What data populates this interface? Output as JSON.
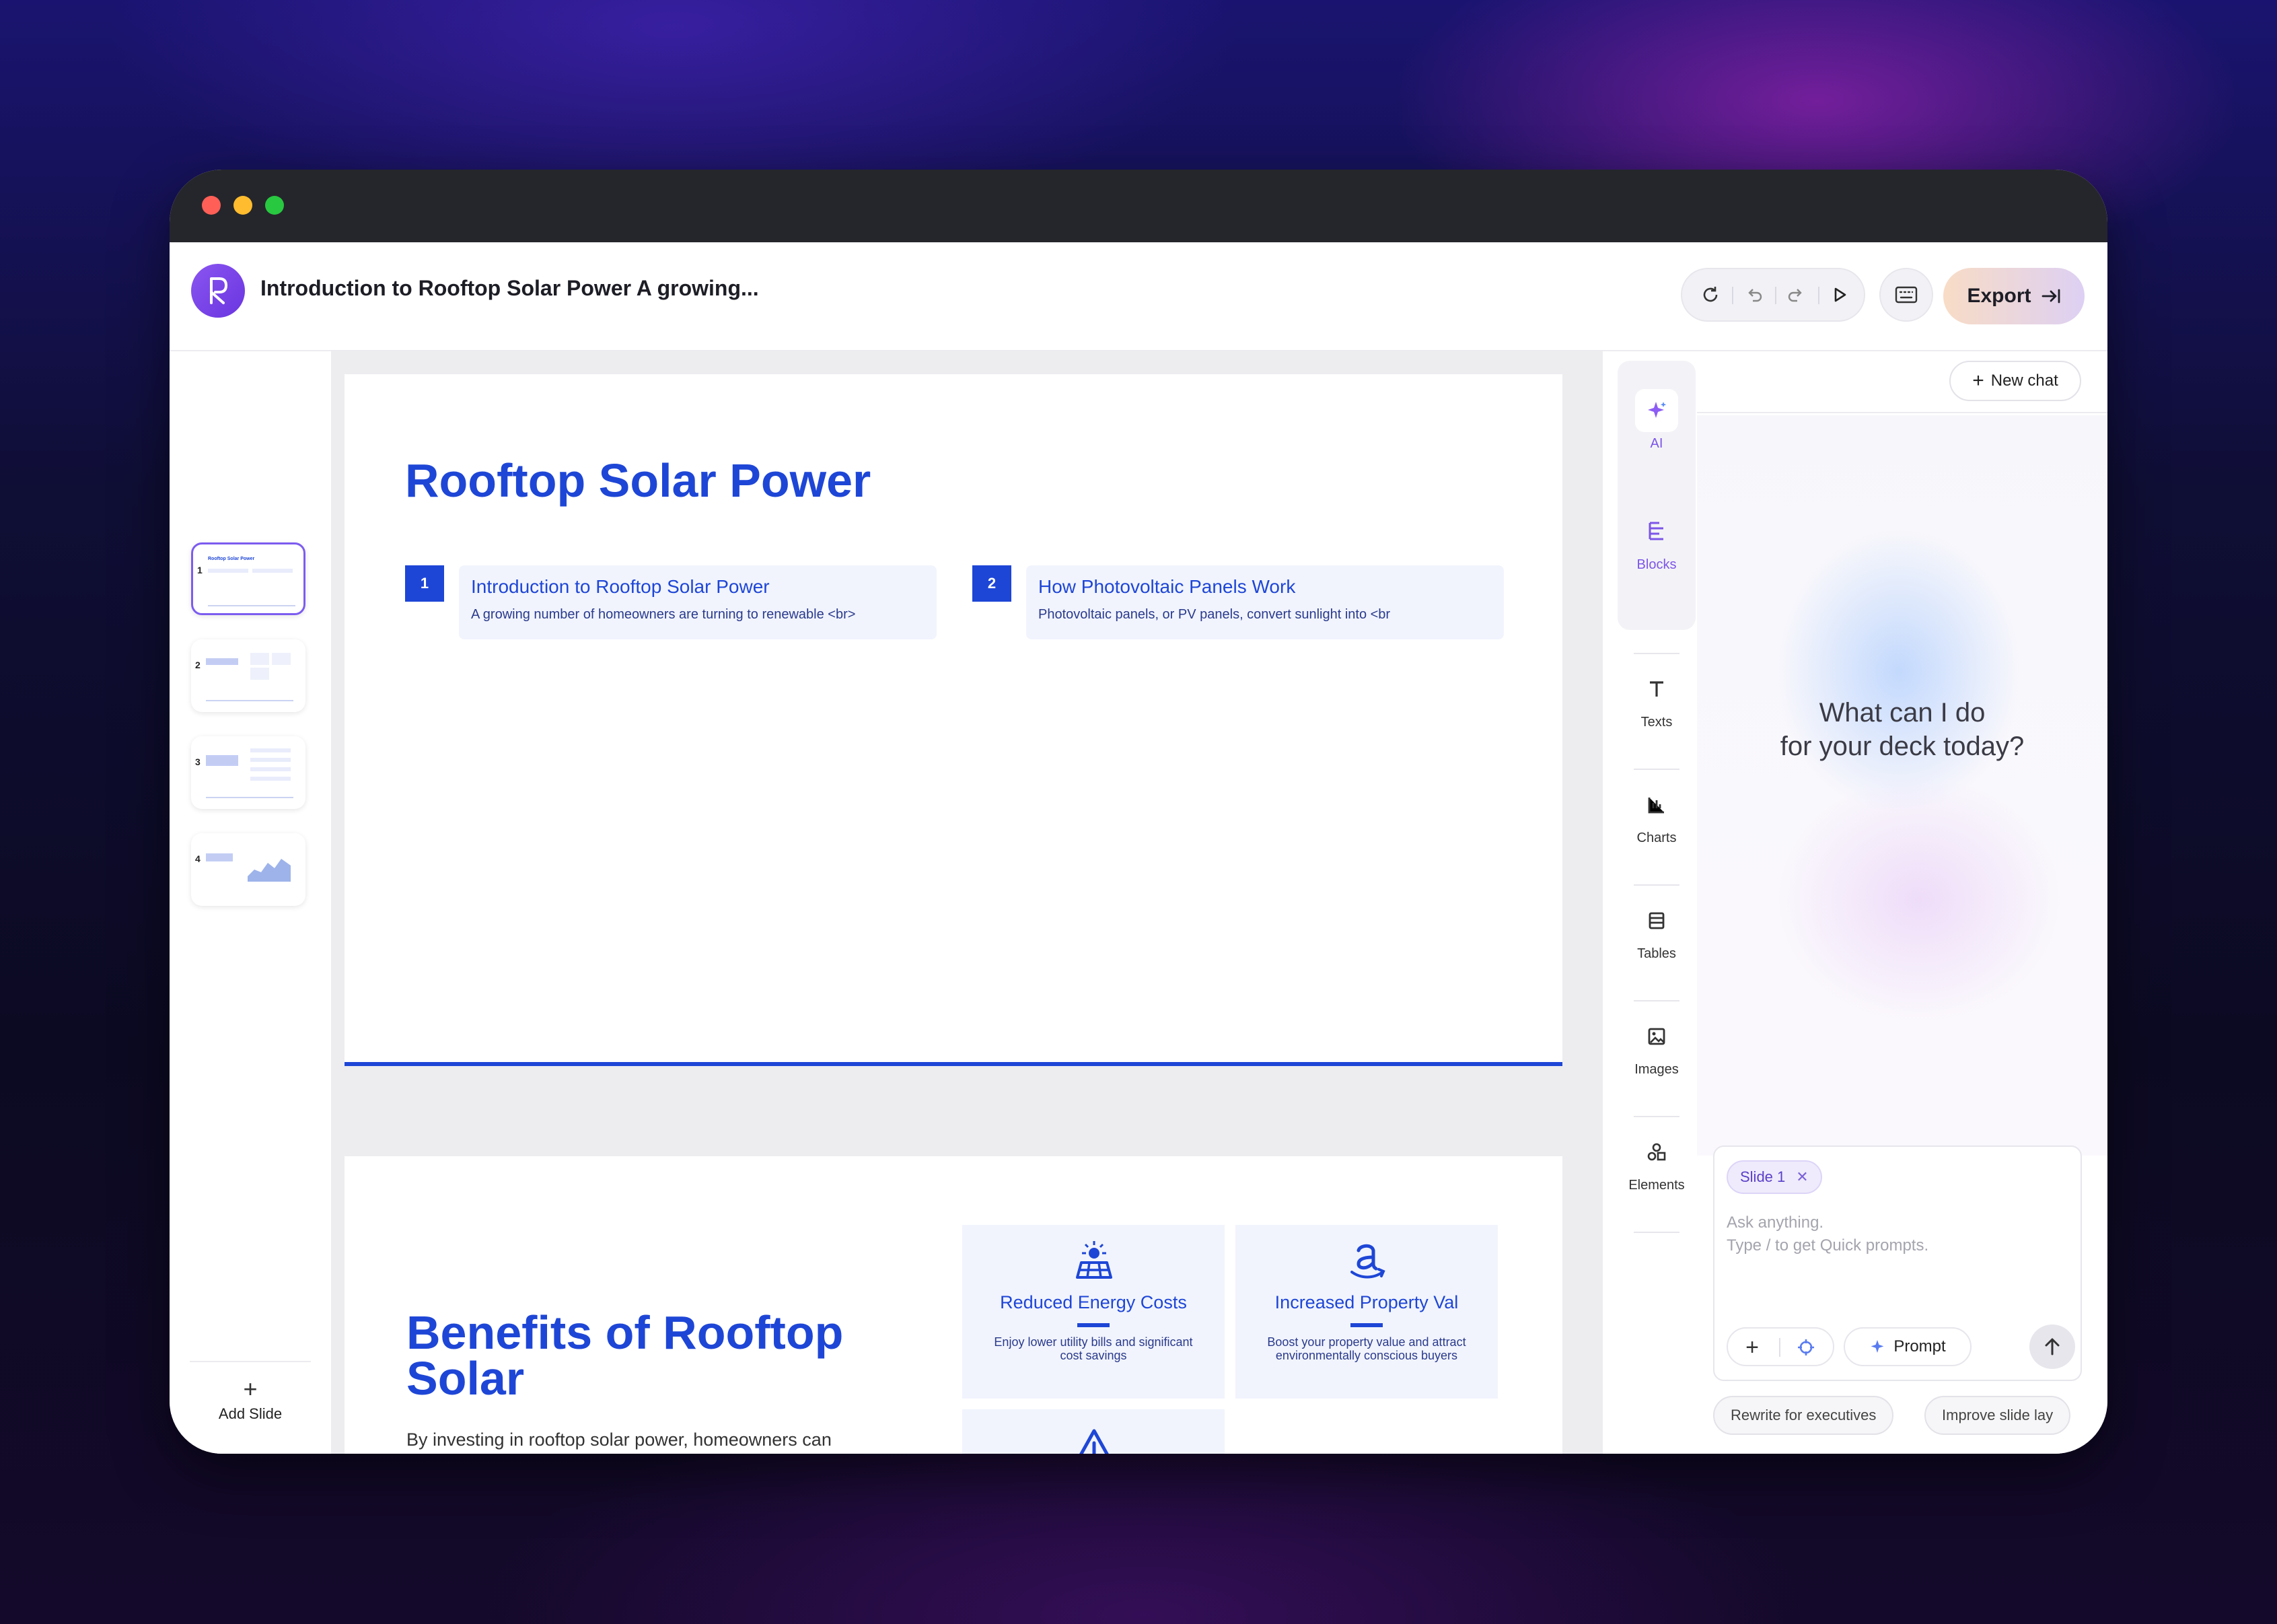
{
  "window": {
    "traffic_lights": [
      "#ff5f57",
      "#febc2e",
      "#28c840"
    ]
  },
  "header": {
    "doc_title": "Introduction to Rooftop Solar Power A growing...",
    "export_label": "Export"
  },
  "thumbnails": [
    {
      "num": "1",
      "title": "Rooftop Solar Power"
    },
    {
      "num": "2",
      "title": "Benefits of Rooftop Solar"
    },
    {
      "num": "3",
      "title": ""
    },
    {
      "num": "4",
      "title": ""
    }
  ],
  "add_slide_label": "Add Slide",
  "slide1": {
    "title": "Rooftop Solar Power",
    "items": [
      {
        "num": "1",
        "heading": "Introduction to Rooftop Solar Power",
        "desc": "A growing number of homeowners are turning to renewable <br>"
      },
      {
        "num": "2",
        "heading": "How Photovoltaic Panels Work",
        "desc": "Photovoltaic panels, or PV panels, convert sunlight into <br"
      }
    ]
  },
  "slide2": {
    "title": "Benefits of Rooftop Solar",
    "body": "By investing in rooftop solar power, homeowners can",
    "cards": [
      {
        "heading": "Reduced Energy Costs",
        "desc": "Enjoy lower utility bills and significant cost savings",
        "icon": "solar-panel-icon"
      },
      {
        "heading": "Increased Property Val",
        "desc": "Boost your property value and attract environmentally conscious buyers",
        "icon": "amazon-icon"
      },
      {
        "heading": "",
        "desc": "",
        "icon": "warning-icon"
      }
    ]
  },
  "rail": {
    "ai": "AI",
    "blocks": "Blocks",
    "texts": "Texts",
    "charts": "Charts",
    "tables": "Tables",
    "images": "Images",
    "elements": "Elements"
  },
  "chat": {
    "new_chat_label": "New chat",
    "greeting_line1": "What can I do",
    "greeting_line2": "for your deck today?",
    "context_chip": "Slide 1",
    "input_line1": "Ask anything.",
    "input_line2": "Type / to get Quick prompts.",
    "prompt_label": "Prompt",
    "suggestions": [
      "Rewrite for executives",
      "Improve slide lay"
    ]
  },
  "colors": {
    "accent": "#1e46d6",
    "brand": "#7c4ff0"
  }
}
